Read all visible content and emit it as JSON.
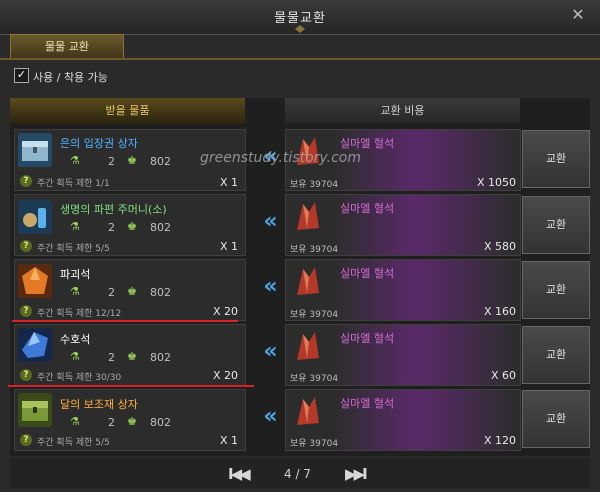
{
  "window": {
    "title": "물물교환",
    "close": "✕"
  },
  "tab": {
    "label": "물물 교환"
  },
  "filter": {
    "label": "사용 / 착용 가능",
    "checked": true
  },
  "headers": {
    "receive": "받을 물품",
    "cost": "교환 비용"
  },
  "watermark": "greenstudy.tistory.com",
  "rows": [
    {
      "name": "은의 입장권 상자",
      "name_color": "#4fb3ff",
      "icon": "silver-chest-icon",
      "level": "2",
      "gear": "802",
      "limit": "주간 획득 제한 1/1",
      "qty": "X 1",
      "material": "실마엘 혈석",
      "owned": "보유 39704",
      "cost": "X 1050",
      "button": "교환"
    },
    {
      "name": "생명의 파편 주머니(소)",
      "name_color": "#7fe07f",
      "icon": "life-shard-pouch-icon",
      "level": "2",
      "gear": "802",
      "limit": "주간 획득 제한 5/5",
      "qty": "X 1",
      "material": "실마엘 혈석",
      "owned": "보유 39704",
      "cost": "X 580",
      "button": "교환"
    },
    {
      "name": "파괴석",
      "name_color": "#ffffff",
      "icon": "destruction-stone-icon",
      "level": "2",
      "gear": "802",
      "limit": "주간 획득 제한 12/12",
      "qty": "X 20",
      "material": "실마엘 혈석",
      "owned": "보유 39704",
      "cost": "X 160",
      "button": "교환"
    },
    {
      "name": "수호석",
      "name_color": "#ffffff",
      "icon": "guardian-stone-icon",
      "level": "2",
      "gear": "802",
      "limit": "주간 획득 제한 30/30",
      "qty": "X 20",
      "material": "실마엘 혈석",
      "owned": "보유 39704",
      "cost": "X 60",
      "button": "교환"
    },
    {
      "name": "달의 보조재 상자",
      "name_color": "#ffb03a",
      "icon": "moon-chest-icon",
      "level": "2",
      "gear": "802",
      "limit": "주간 획득 제한 5/5",
      "qty": "X 1",
      "material": "실마엘 혈석",
      "owned": "보유 39704",
      "cost": "X 120",
      "button": "교환"
    }
  ],
  "pager": {
    "first": "I◀◀",
    "prev": "◀",
    "text": "4 / 7",
    "next": "▶",
    "last": "▶▶I"
  },
  "colors": {
    "accent_gold": "#e6c970",
    "arrow_blue": "#4aa7e6",
    "material_purple": "#d56bd6",
    "underline_red": "#d8222a"
  }
}
